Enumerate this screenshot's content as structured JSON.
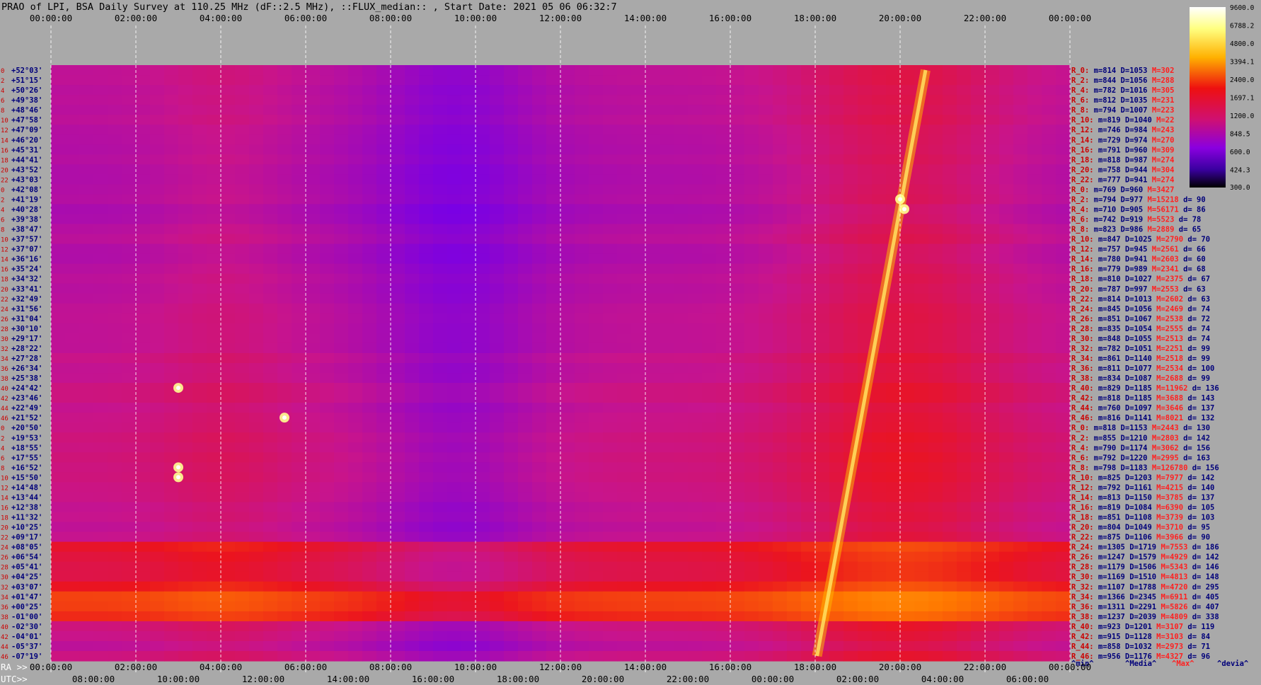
{
  "chart_data": {
    "type": "heatmap",
    "title": "PRAO of LPI, BSA Daily Survey at 110.25 MHz (dF::2.5 MHz), ::FLUX_median:: , Start Date: 2021 05 06 06:32:7",
    "colorbar_ticks": [
      "9600.0",
      "6788.2",
      "4800.0",
      "3394.1",
      "2400.0",
      "1697.1",
      "1200.0",
      "848.5",
      "600.0",
      "424.3",
      "300.0"
    ],
    "colorbar_range": [
      300,
      9600
    ],
    "colorbar_scale": "log",
    "top_time_labels": [
      "00:00:00",
      "02:00:00",
      "04:00:00",
      "06:00:00",
      "08:00:00",
      "10:00:00",
      "12:00:00",
      "14:00:00",
      "16:00:00",
      "18:00:00",
      "20:00:00",
      "22:00:00",
      "00:00:00"
    ],
    "ra_prefix": "RA >>",
    "ra_labels": [
      "00:00:00",
      "02:00:00",
      "04:00:00",
      "06:00:00",
      "08:00:00",
      "10:00:00",
      "12:00:00",
      "14:00:00",
      "16:00:00",
      "18:00:00",
      "20:00:00",
      "22:00:00",
      "00:00:00"
    ],
    "utc_prefix": "UTC>>",
    "utc_labels": [
      "08:00:00",
      "10:00:00",
      "12:00:00",
      "14:00:00",
      "16:00:00",
      "18:00:00",
      "20:00:00",
      "22:00:00",
      "00:00:00",
      "02:00:00",
      "04:00:00",
      "06:00:00"
    ],
    "declinations": [
      "+52°03'",
      "+51°15'",
      "+50°26'",
      "+49°38'",
      "+48°46'",
      "+47°58'",
      "+47°09'",
      "+46°20'",
      "+45°31'",
      "+44°41'",
      "+43°52'",
      "+43°03'",
      "+42°08'",
      "+41°19'",
      "+40°28'",
      "+39°38'",
      "+38°47'",
      "+37°57'",
      "+37°07'",
      "+36°16'",
      "+35°24'",
      "+34°32'",
      "+33°41'",
      "+32°49'",
      "+31°56'",
      "+31°04'",
      "+30°10'",
      "+29°17'",
      "+28°22'",
      "+27°28'",
      "+26°34'",
      "+25°38'",
      "+24°42'",
      "+23°46'",
      "+22°49'",
      "+21°52'",
      "+20°50'",
      "+19°53'",
      "+18°55'",
      "+17°55'",
      "+16°52'",
      "+15°50'",
      "+14°48'",
      "+13°44'",
      "+12°38'",
      "+11°32'",
      "+10°25'",
      "+09°17'",
      "+08°05'",
      "+06°54'",
      "+05°41'",
      "+04°25'",
      "+03°07'",
      "+01°47'",
      "+00°25'",
      "-01°00'",
      "-02°30'",
      "-04°01'",
      "-05°37'",
      "-07°19'"
    ],
    "row_indices": [
      "0",
      "2",
      "4",
      "6",
      "8",
      "10",
      "12",
      "14",
      "16",
      "18",
      "20",
      "22",
      "0",
      "2",
      "4",
      "6",
      "8",
      "10",
      "12",
      "14",
      "16",
      "18",
      "20",
      "22",
      "24",
      "26",
      "28",
      "30",
      "32",
      "34",
      "36",
      "38",
      "40",
      "42",
      "44",
      "46",
      "0",
      "2",
      "4",
      "6",
      "8",
      "10",
      "12",
      "14",
      "16",
      "18",
      "20",
      "22",
      "24",
      "26",
      "28",
      "30",
      "32",
      "34",
      "36",
      "38",
      "40",
      "42",
      "44",
      "46"
    ],
    "stats": [
      {
        "r": "R_0:",
        "m": "814",
        "d": "1053",
        "M": "302",
        "dev": ""
      },
      {
        "r": "R_2:",
        "m": "844",
        "d": "1056",
        "M": "288",
        "dev": ""
      },
      {
        "r": "R_4:",
        "m": "782",
        "d": "1016",
        "M": "305",
        "dev": ""
      },
      {
        "r": "R_6:",
        "m": "812",
        "d": "1035",
        "M": "231",
        "dev": ""
      },
      {
        "r": "R_8:",
        "m": "794",
        "d": "1007",
        "M": "223",
        "dev": ""
      },
      {
        "r": "R_10:",
        "m": "819",
        "d": "1040",
        "M": "22",
        "dev": ""
      },
      {
        "r": "R_12:",
        "m": "746",
        "d": "984",
        "M": "243",
        "dev": ""
      },
      {
        "r": "R_14:",
        "m": "729",
        "d": "974",
        "M": "270",
        "dev": ""
      },
      {
        "r": "R_16:",
        "m": "791",
        "d": "960",
        "M": "309",
        "dev": ""
      },
      {
        "r": "R_18:",
        "m": "818",
        "d": "987",
        "M": "274",
        "dev": ""
      },
      {
        "r": "R_20:",
        "m": "758",
        "d": "944",
        "M": "304",
        "dev": ""
      },
      {
        "r": "R_22:",
        "m": "777",
        "d": "941",
        "M": "274",
        "dev": ""
      },
      {
        "r": "R_0:",
        "m": "769",
        "d": "960",
        "M": "3427",
        "dev": ""
      },
      {
        "r": "R_2:",
        "m": "794",
        "d": "977",
        "M": "15218",
        "dev": "d= 90"
      },
      {
        "r": "R_4:",
        "m": "710",
        "d": "905",
        "M": "56171",
        "dev": "d= 86"
      },
      {
        "r": "R_6:",
        "m": "742",
        "d": "919",
        "M": "5523",
        "dev": "d= 78"
      },
      {
        "r": "R_8:",
        "m": "823",
        "d": "986",
        "M": "2889",
        "dev": "d= 65"
      },
      {
        "r": "R_10:",
        "m": "847",
        "d": "1025",
        "M": "2790",
        "dev": "d= 70"
      },
      {
        "r": "R_12:",
        "m": "757",
        "d": "945",
        "M": "2561",
        "dev": "d= 66"
      },
      {
        "r": "R_14:",
        "m": "780",
        "d": "941",
        "M": "2603",
        "dev": "d= 60"
      },
      {
        "r": "R_16:",
        "m": "779",
        "d": "989",
        "M": "2341",
        "dev": "d= 68"
      },
      {
        "r": "R_18:",
        "m": "810",
        "d": "1027",
        "M": "2375",
        "dev": "d= 67"
      },
      {
        "r": "R_20:",
        "m": "787",
        "d": "997",
        "M": "2553",
        "dev": "d= 63"
      },
      {
        "r": "R_22:",
        "m": "814",
        "d": "1013",
        "M": "2602",
        "dev": "d= 63"
      },
      {
        "r": "R_24:",
        "m": "845",
        "d": "1056",
        "M": "2469",
        "dev": "d= 74"
      },
      {
        "r": "R_26:",
        "m": "851",
        "d": "1067",
        "M": "2538",
        "dev": "d= 72"
      },
      {
        "r": "R_28:",
        "m": "835",
        "d": "1054",
        "M": "2555",
        "dev": "d= 74"
      },
      {
        "r": "R_30:",
        "m": "848",
        "d": "1055",
        "M": "2513",
        "dev": "d= 74"
      },
      {
        "r": "R_32:",
        "m": "782",
        "d": "1051",
        "M": "2251",
        "dev": "d= 99"
      },
      {
        "r": "R_34:",
        "m": "861",
        "d": "1140",
        "M": "2518",
        "dev": "d= 99"
      },
      {
        "r": "R_36:",
        "m": "811",
        "d": "1077",
        "M": "2534",
        "dev": "d= 100"
      },
      {
        "r": "R_38:",
        "m": "834",
        "d": "1087",
        "M": "2688",
        "dev": "d= 99"
      },
      {
        "r": "R_40:",
        "m": "829",
        "d": "1185",
        "M": "11962",
        "dev": "d= 136"
      },
      {
        "r": "R_42:",
        "m": "818",
        "d": "1185",
        "M": "3688",
        "dev": "d= 143"
      },
      {
        "r": "R_44:",
        "m": "760",
        "d": "1097",
        "M": "3646",
        "dev": "d= 137"
      },
      {
        "r": "R_46:",
        "m": "816",
        "d": "1141",
        "M": "8021",
        "dev": "d= 132"
      },
      {
        "r": "R_0:",
        "m": "818",
        "d": "1153",
        "M": "2443",
        "dev": "d= 130"
      },
      {
        "r": "R_2:",
        "m": "855",
        "d": "1210",
        "M": "2803",
        "dev": "d= 142"
      },
      {
        "r": "R_4:",
        "m": "790",
        "d": "1174",
        "M": "3062",
        "dev": "d= 156"
      },
      {
        "r": "R_6:",
        "m": "792",
        "d": "1220",
        "M": "2995",
        "dev": "d= 163"
      },
      {
        "r": "R_8:",
        "m": "798",
        "d": "1183",
        "M": "126780",
        "dev": "d= 156"
      },
      {
        "r": "R_10:",
        "m": "825",
        "d": "1203",
        "M": "7977",
        "dev": "d= 142"
      },
      {
        "r": "R_12:",
        "m": "792",
        "d": "1161",
        "M": "4215",
        "dev": "d= 140"
      },
      {
        "r": "R_14:",
        "m": "813",
        "d": "1150",
        "M": "3785",
        "dev": "d= 137"
      },
      {
        "r": "R_16:",
        "m": "819",
        "d": "1084",
        "M": "6390",
        "dev": "d= 105"
      },
      {
        "r": "R_18:",
        "m": "851",
        "d": "1108",
        "M": "3739",
        "dev": "d= 103"
      },
      {
        "r": "R_20:",
        "m": "804",
        "d": "1049",
        "M": "3710",
        "dev": "d= 95"
      },
      {
        "r": "R_22:",
        "m": "875",
        "d": "1106",
        "M": "3966",
        "dev": "d= 90"
      },
      {
        "r": "R_24:",
        "m": "1305",
        "d": "1719",
        "M": "7553",
        "dev": "d= 186"
      },
      {
        "r": "R_26:",
        "m": "1247",
        "d": "1579",
        "M": "4929",
        "dev": "d= 142"
      },
      {
        "r": "R_28:",
        "m": "1179",
        "d": "1506",
        "M": "5343",
        "dev": "d= 146"
      },
      {
        "r": "R_30:",
        "m": "1169",
        "d": "1510",
        "M": "4813",
        "dev": "d= 148"
      },
      {
        "r": "R_32:",
        "m": "1107",
        "d": "1788",
        "M": "4720",
        "dev": "d= 295"
      },
      {
        "r": "R_34:",
        "m": "1366",
        "d": "2345",
        "M": "6911",
        "dev": "d= 405"
      },
      {
        "r": "R_36:",
        "m": "1311",
        "d": "2291",
        "M": "5826",
        "dev": "d= 407"
      },
      {
        "r": "R_38:",
        "m": "1237",
        "d": "2039",
        "M": "4809",
        "dev": "d= 338"
      },
      {
        "r": "R_40:",
        "m": "923",
        "d": "1201",
        "M": "3107",
        "dev": "d= 119"
      },
      {
        "r": "R_42:",
        "m": "915",
        "d": "1128",
        "M": "3103",
        "dev": "d= 84"
      },
      {
        "r": "R_44:",
        "m": "858",
        "d": "1032",
        "M": "2973",
        "dev": "d= 71"
      },
      {
        "r": "R_46:",
        "m": "956",
        "d": "1176",
        "M": "4327",
        "dev": "d= 96"
      }
    ],
    "stats_footer": [
      "^min^",
      "^Media^",
      "^Max^",
      "^devia^"
    ],
    "colors": {
      "background": "#a9a9a9",
      "stat_label": "#cc0000",
      "stat_text": "#00007a",
      "stat_max": "#ff2020",
      "dec_label": "#00007a",
      "index_label": "#cc0000"
    }
  }
}
